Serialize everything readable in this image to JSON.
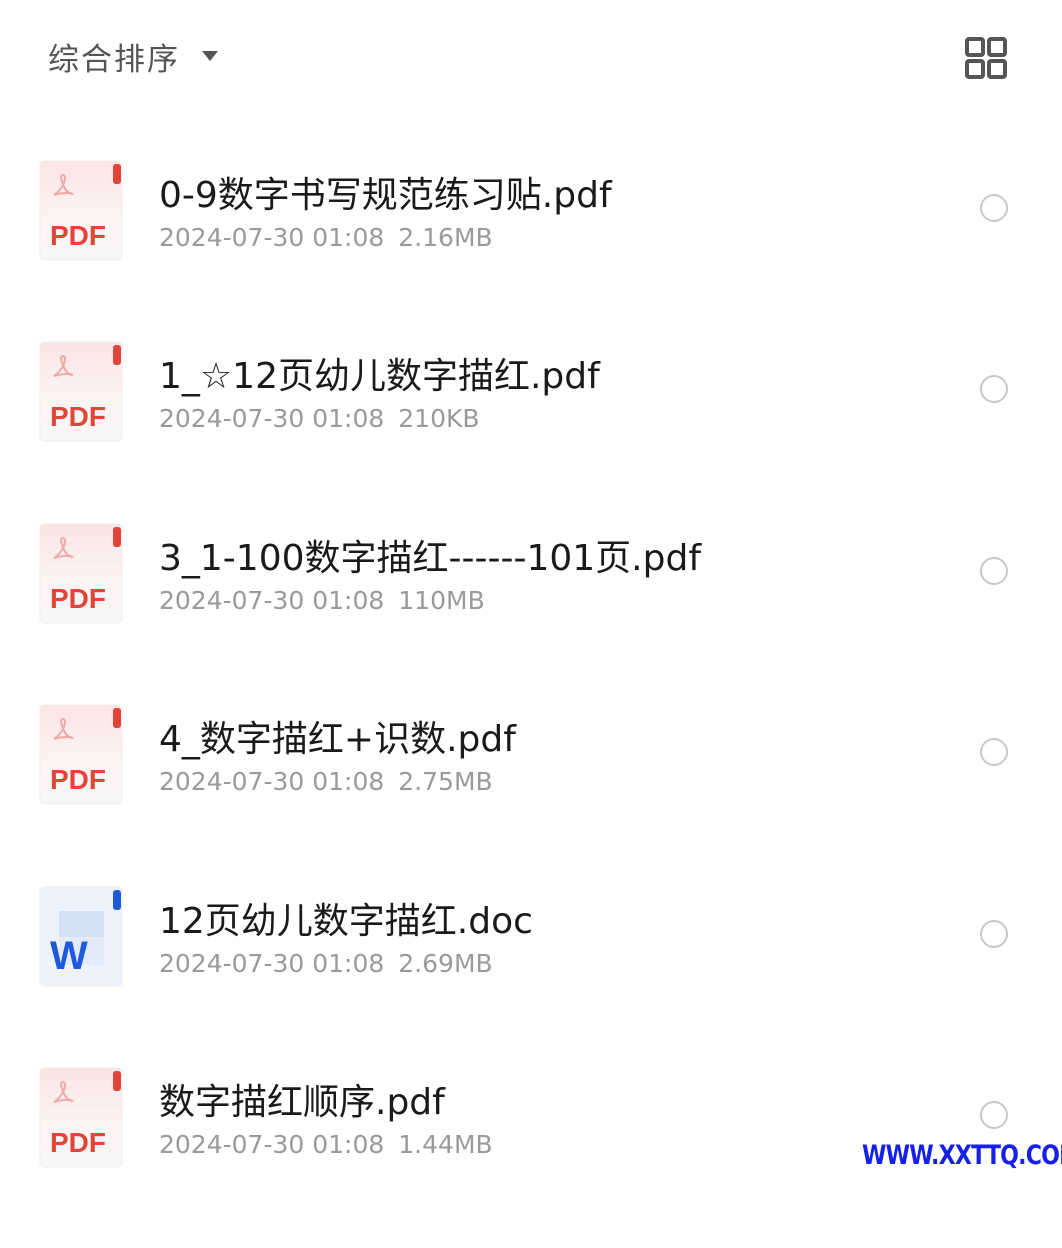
{
  "toolbar": {
    "sort_label": "综合排序",
    "sort_caret_icon": "caret-down-icon",
    "view_toggle_icon": "grid-view-icon"
  },
  "colors": {
    "pdf_red": "#e0453a",
    "word_blue": "#1e5bd8",
    "text_primary": "#1a1a1a",
    "text_secondary": "#9a9a9a"
  },
  "files": [
    {
      "name": "0-9数字书写规范练习贴.pdf",
      "date": "2024-07-30 01:08",
      "size": "2.16MB",
      "type": "pdf",
      "icon_label": "PDF",
      "icon": "pdf-file-icon"
    },
    {
      "name": "1_☆12页幼儿数字描红.pdf",
      "date": "2024-07-30 01:08",
      "size": "210KB",
      "type": "pdf",
      "icon_label": "PDF",
      "icon": "pdf-file-icon"
    },
    {
      "name": "3_1-100数字描红------101页.pdf",
      "date": "2024-07-30 01:08",
      "size": "110MB",
      "type": "pdf",
      "icon_label": "PDF",
      "icon": "pdf-file-icon"
    },
    {
      "name": "4_数字描红+识数.pdf",
      "date": "2024-07-30 01:08",
      "size": "2.75MB",
      "type": "pdf",
      "icon_label": "PDF",
      "icon": "pdf-file-icon"
    },
    {
      "name": "12页幼儿数字描红.doc",
      "date": "2024-07-30 01:08",
      "size": "2.69MB",
      "type": "doc",
      "icon_label": "W",
      "icon": "word-file-icon"
    },
    {
      "name": "数字描红顺序.pdf",
      "date": "2024-07-30 01:08",
      "size": "1.44MB",
      "type": "pdf",
      "icon_label": "PDF",
      "icon": "pdf-file-icon"
    }
  ],
  "watermark": "WWW.XXTTQ.COM"
}
